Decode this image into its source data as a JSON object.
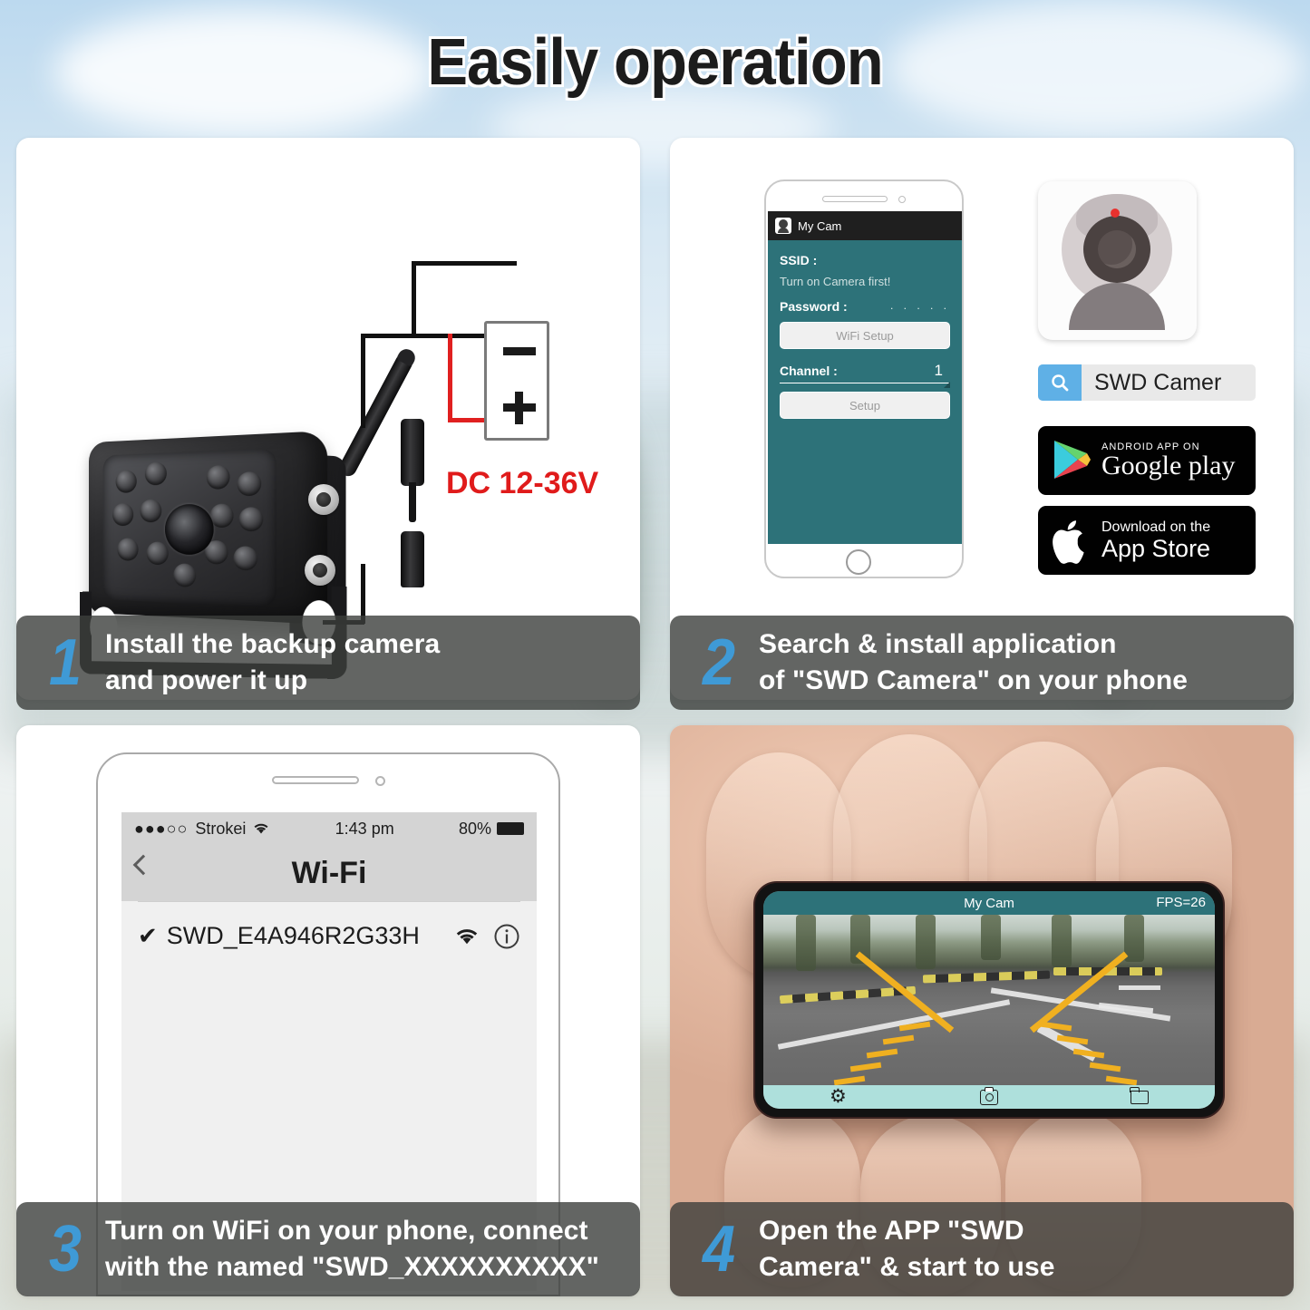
{
  "header": {
    "title": "Easily operation"
  },
  "steps": [
    {
      "number": "1",
      "line1": "Install the backup camera",
      "line2": "and power it up"
    },
    {
      "number": "2",
      "line1": "Search & install application",
      "line2": "of \"SWD Camera\" on your phone"
    },
    {
      "number": "3",
      "line1": "Turn on WiFi on your phone, connect",
      "line2": "with the named \"SWD_XXXXXXXXXX\""
    },
    {
      "number": "4",
      "line1": "Open the APP \"SWD",
      "line2": "Camera\" & start to use"
    }
  ],
  "panel1": {
    "power_label": "DC 12-36V",
    "battery_negative": "-",
    "battery_positive": "+"
  },
  "panel2": {
    "app_bar_title": "My Cam",
    "ssid_label": "SSID :",
    "ssid_hint": "Turn on Camera first!",
    "password_label": "Password :",
    "password_value": ". . . . .",
    "wifi_setup_button": "WiFi Setup",
    "channel_label": "Channel :",
    "channel_value": "1",
    "setup_button": "Setup",
    "search_value": "SWD Camer",
    "google_play_sub": "ANDROID APP ON",
    "google_play_main": "Google play",
    "app_store_sub": "Download on the",
    "app_store_main": "App Store"
  },
  "panel3": {
    "carrier": "Strokei",
    "time": "1:43 pm",
    "battery": "80%",
    "nav_title": "Wi-Fi",
    "network_name": "SWD_E4A946R2G33H",
    "network_check": "✔"
  },
  "panel4": {
    "app_title": "My Cam",
    "fps": "FPS=26"
  },
  "colors": {
    "accent_blue": "#3f9ad6",
    "app_teal": "#2d7279",
    "toolbar_mint": "#aee0dc",
    "power_red": "#e01b1b",
    "search_blue": "#5fb0e6"
  }
}
